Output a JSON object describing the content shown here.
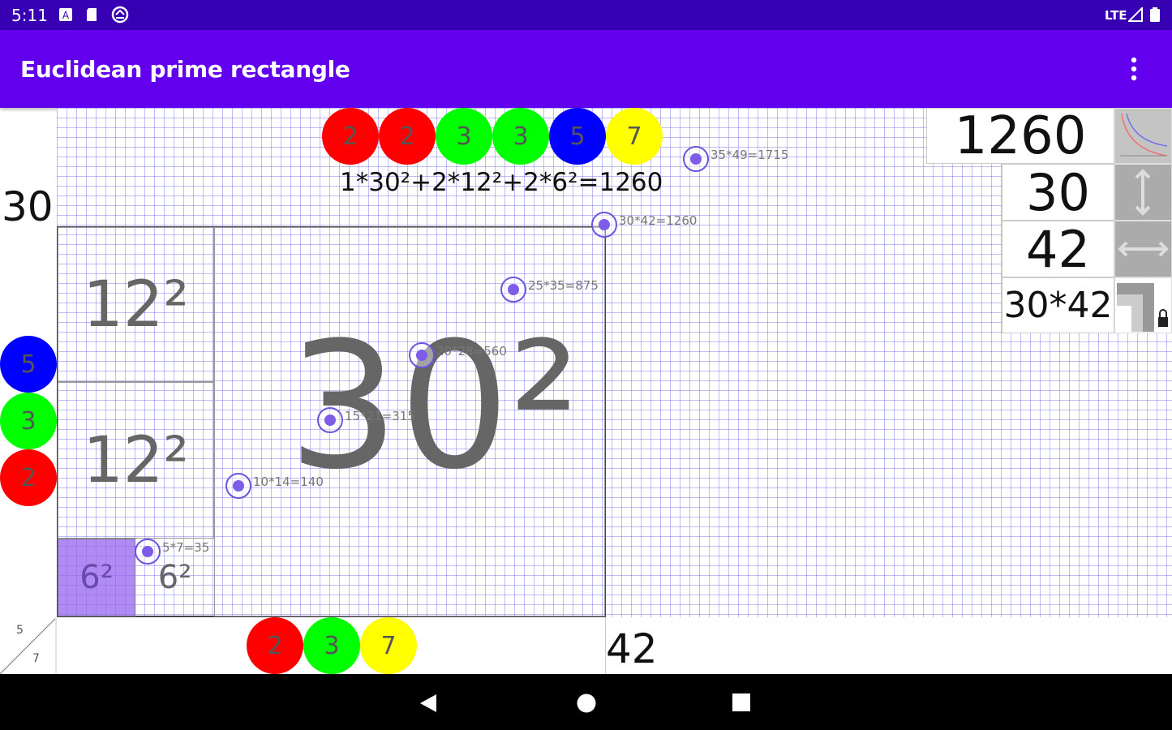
{
  "status": {
    "time": "5:11",
    "network": "LTE"
  },
  "app": {
    "title": "Euclidean prime rectangle"
  },
  "icons": {
    "status_left": [
      "notification-a-icon",
      "sd-card-icon",
      "sync-icon"
    ],
    "status_right": [
      "lte-signal-icon",
      "battery-icon"
    ],
    "toolbar": [
      "overflow-menu-icon"
    ],
    "tools": [
      "curve-graph-icon",
      "vertical-arrows-icon",
      "horizontal-arrows-icon",
      "nested-squares-lock-icon"
    ],
    "nav": [
      "back-icon",
      "home-icon",
      "recents-icon"
    ]
  },
  "colors": {
    "status_bar": "#3700b3",
    "app_bar": "#6200ee",
    "grid_line": "#6e6ee6",
    "highlight_square": "#a070f0",
    "prime_2": "#ff0000",
    "prime_3": "#00ff00",
    "prime_5": "#0000ff",
    "prime_7": "#ffff00"
  },
  "top_primes": [
    "2",
    "2",
    "3",
    "3",
    "5",
    "7"
  ],
  "left_primes": [
    "5",
    "3",
    "2"
  ],
  "bottom_primes": [
    "2",
    "3",
    "7"
  ],
  "formula": "1*30²+2*12²+2*6²=1260",
  "left_dim": "30",
  "bottom_dim": "42",
  "squares": {
    "big": "30²",
    "mid1": "12²",
    "mid2": "12²",
    "small_filled": "6²",
    "small_plain": "6²"
  },
  "points": [
    {
      "label": "35*49=1715"
    },
    {
      "label": "30*42=1260"
    },
    {
      "label": "25*35=875"
    },
    {
      "label": "20*28=560"
    },
    {
      "label": "15*21=315"
    },
    {
      "label": "10*14=140"
    },
    {
      "label": "5*7=35"
    }
  ],
  "panel": {
    "area": "1260",
    "height": "30",
    "width": "42",
    "product": "30*42"
  },
  "ratio": {
    "top": "5",
    "bottom": "7"
  }
}
